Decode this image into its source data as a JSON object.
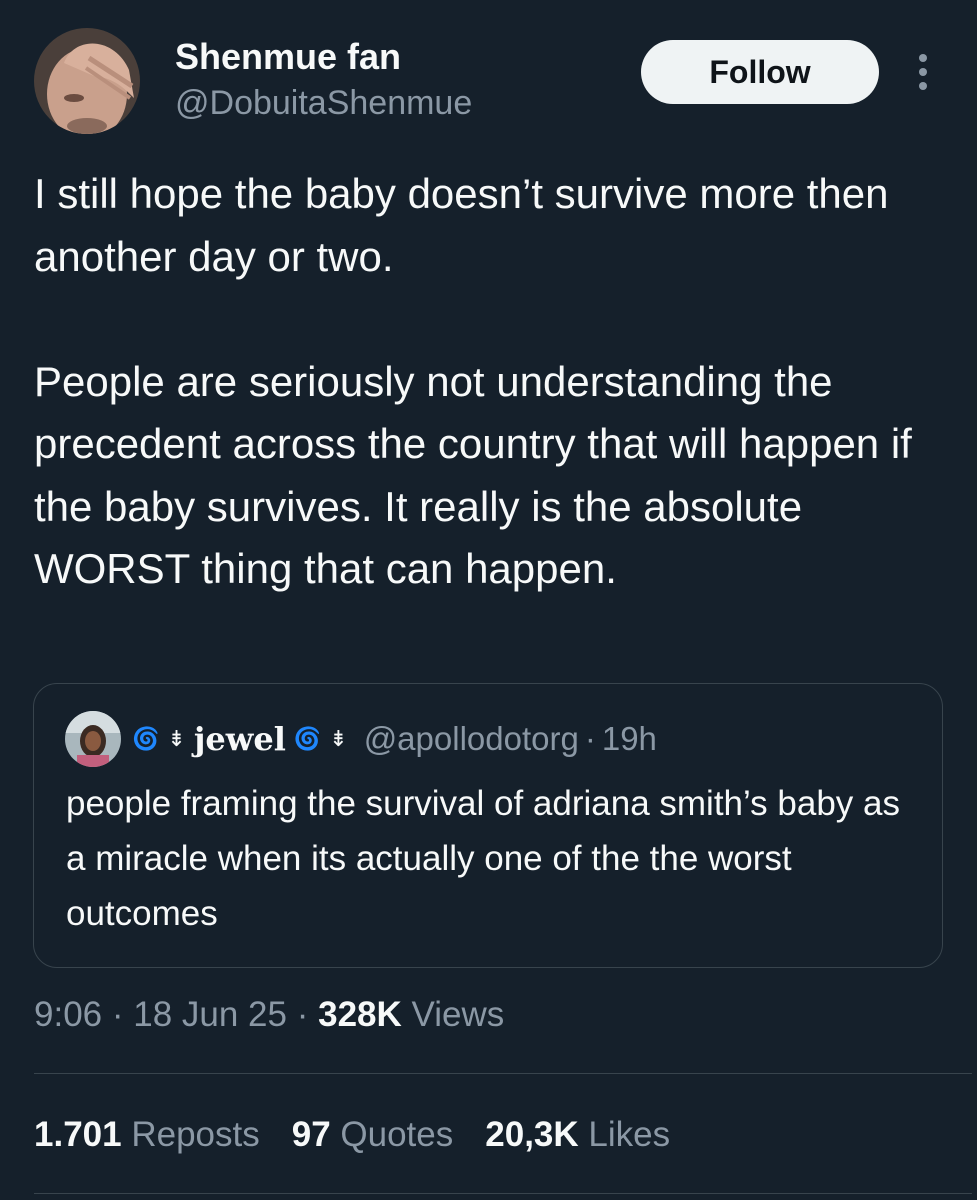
{
  "author": {
    "display_name": "Shenmue fan",
    "handle": "@DobuitaShenmue",
    "avatar_icon": "person-facepalm-avatar"
  },
  "follow_label": "Follow",
  "more_icon": "vertical-ellipsis-icon",
  "tweet_text": "I still hope the baby doesn’t survive more then another day or two.\n\nPeople are seriously not understanding the precedent across the country that will happen if the baby survives. It really is the absolute WORST thing that can happen.",
  "quote": {
    "avatar_icon": "quoted-user-avatar",
    "emoji_spiral": "🌀",
    "emoji_arrows": "⇟",
    "name": "jewel",
    "handle": "@apollodotorg",
    "time": "19h",
    "separator": "·",
    "text": "people framing the survival of adriana smith’s baby as a miracle when its actually one of the the worst outcomes"
  },
  "meta": {
    "time": "9:06",
    "date": "18 Jun 25",
    "separator": "·",
    "views_count": "328K",
    "views_label": "Views"
  },
  "stats": {
    "reposts_count": "1.701",
    "reposts_label": "Reposts",
    "quotes_count": "97",
    "quotes_label": "Quotes",
    "likes_count": "20,3K",
    "likes_label": "Likes"
  },
  "colors": {
    "background": "#15202b",
    "primary_text": "#f7f9f9",
    "secondary_text": "#8b98a5",
    "border": "#38444d",
    "follow_button_bg": "#eff3f4"
  }
}
